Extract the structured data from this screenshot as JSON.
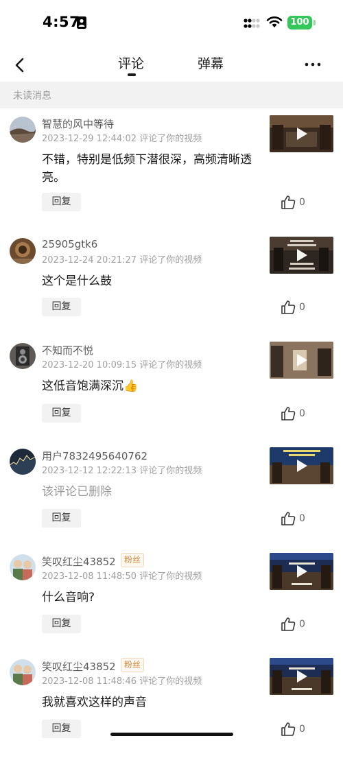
{
  "status_bar": {
    "time": "4:57",
    "battery": "100"
  },
  "nav": {
    "tabs": [
      {
        "label": "评论",
        "active": true
      },
      {
        "label": "弹幕",
        "active": false
      }
    ],
    "icons": {
      "back": "chevron-left-icon",
      "more": "more-horizontal-icon"
    }
  },
  "section": {
    "title": "未读消息"
  },
  "reply_label": "回复",
  "colors": {
    "battery_green": "#34c759",
    "fan_badge_text": "#c98a3d",
    "muted_text": "#a0a0a0"
  },
  "comments": [
    {
      "username": "智慧的风中等待",
      "meta": "2023-12-29 12:44:02 评论了你的视频",
      "text": "不错，特别是低频下潜很深，高频清晰透亮。",
      "likes": "0",
      "badge": ""
    },
    {
      "username": "25905gtk6",
      "meta": "2023-12-24 20:21:27 评论了你的视频",
      "text": "这个是什么鼓",
      "likes": "0",
      "badge": ""
    },
    {
      "username": "不知而不悦",
      "meta": "2023-12-20 10:09:15 评论了你的视频",
      "text": "这低音饱满深沉",
      "emoji": "👍",
      "likes": "0",
      "badge": ""
    },
    {
      "username": "用户7832495640762",
      "meta": "2023-12-12 12:22:13 评论了你的视频",
      "text": "该评论已删除",
      "likes": "0",
      "badge": "",
      "deleted": true
    },
    {
      "username": "笑叹红尘43852",
      "meta": "2023-12-08 11:48:50 评论了你的视频",
      "text": "什么音响?",
      "likes": "0",
      "badge": "粉丝"
    },
    {
      "username": "笑叹红尘43852",
      "meta": "2023-12-08 11:48:46 评论了你的视频",
      "text": "我就喜欢这样的声音",
      "likes": "0",
      "badge": "粉丝"
    }
  ]
}
